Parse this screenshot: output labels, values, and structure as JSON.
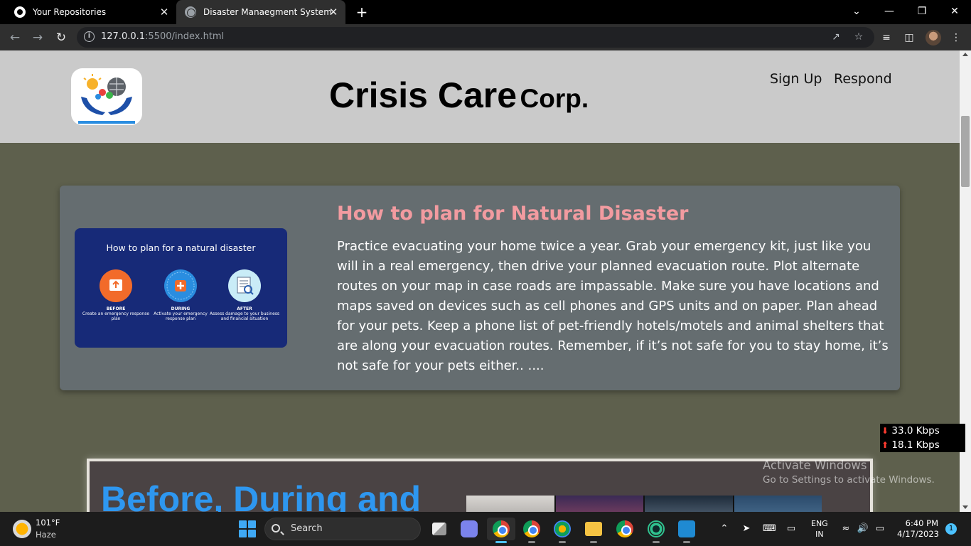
{
  "browser": {
    "tabs": [
      {
        "title": "Your Repositories",
        "icon": "github-icon",
        "active": false
      },
      {
        "title": "Disaster Manaegment System",
        "icon": "globe-icon",
        "active": true
      }
    ],
    "new_tab_label": "+",
    "tab_close_glyph": "✕",
    "url_host": "127.0.0.1",
    "url_rest": ":5500/index.html",
    "window_controls": {
      "minimize": "—",
      "maximize": "❐",
      "close": "✕",
      "tab_search": "⌄"
    }
  },
  "site": {
    "title_main": "Crisis Care",
    "title_suffix": "Corp.",
    "nav": [
      "Sign Up",
      "Respond"
    ]
  },
  "card": {
    "heading": "How to plan for Natural Disaster",
    "body": "Practice evacuating your home twice a year. Grab your emergency kit, just like you will in a real emergency, then drive your planned evacuation route. Plot alternate routes on your map in case roads are impassable. Make sure you have locations and maps saved on devices such as cell phones and GPS units and on paper. Plan ahead for your pets. Keep a phone list of pet-friendly hotels/motels and animal shelters that are along your evacuation routes. Remember, if it’s not safe for you to stay home, it’s not safe for your pets either.. ....",
    "infographic": {
      "title": "How to plan for a natural disaster",
      "phases": [
        {
          "label": "BEFORE",
          "desc": "Create an emergency response plan",
          "color": "#f26b2a"
        },
        {
          "label": "DURING",
          "desc": "Activate your emergency response plan",
          "color": "#2a8de0"
        },
        {
          "label": "AFTER",
          "desc": "Assess damage to your business and financial situation",
          "color": "#5cc3e6"
        }
      ]
    }
  },
  "section2": {
    "title": "Before, During and"
  },
  "overlay": {
    "activate_title": "Activate Windows",
    "activate_sub": "Go to Settings to activate Windows.",
    "net_down": "33.0 Kbps",
    "net_up": "18.1 Kbps"
  },
  "taskbar": {
    "temp": "101°F",
    "condition": "Haze",
    "search_label": "Search",
    "lang_line1": "ENG",
    "lang_line2": "IN",
    "time": "6:40 PM",
    "date": "4/17/2023",
    "notifications": "1"
  },
  "colors": {
    "page_bg": "#5e604d",
    "header_bg": "#cacaca",
    "card_bg": "#656d70",
    "card_heading": "#f29ba0",
    "section2_title": "#2e97f0"
  }
}
